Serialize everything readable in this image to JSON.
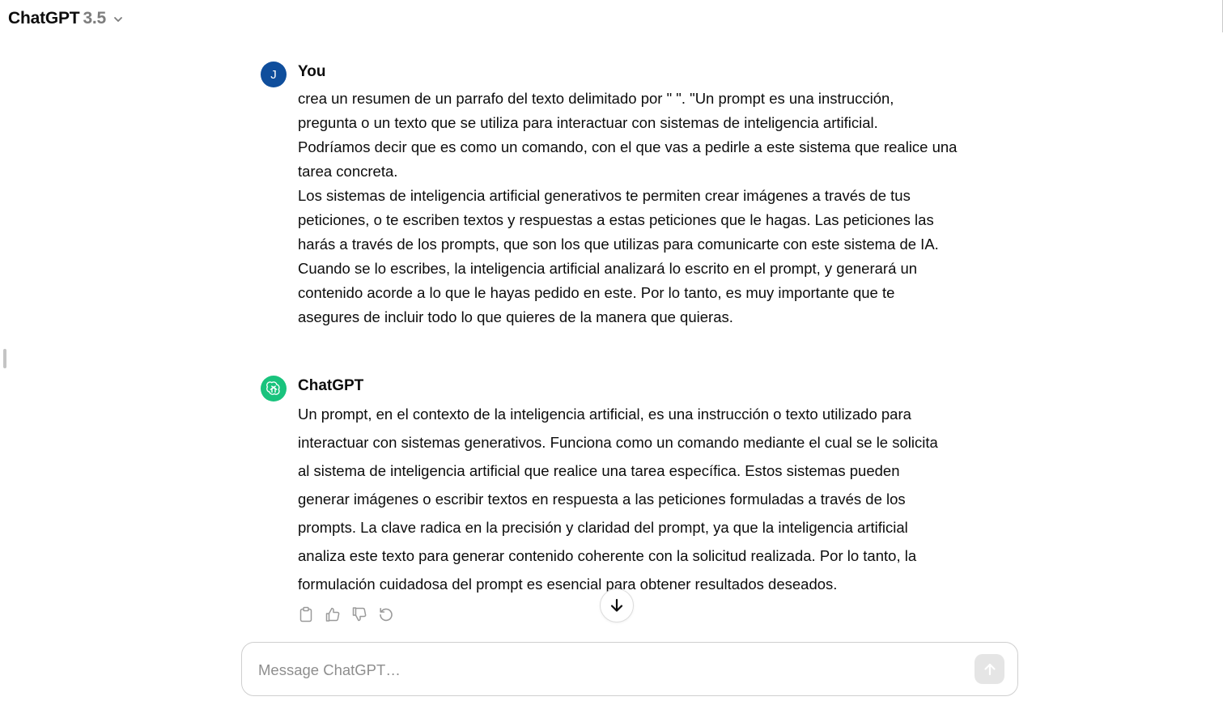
{
  "header": {
    "model_name": "ChatGPT",
    "model_version": "3.5"
  },
  "conversation": {
    "user_message": {
      "avatar_initial": "J",
      "author": "You",
      "lines": [
        "crea un resumen de un parrafo del texto delimitado por \" \".  \"Un prompt es una instrucción,",
        "pregunta o un texto que se utiliza para interactuar con sistemas de inteligencia artificial.",
        "Podríamos decir que es como un comando, con el que vas a pedirle a este sistema que realice una",
        "tarea concreta.",
        "Los sistemas de inteligencia artificial generativos te permiten crear imágenes a través de tus",
        "peticiones, o te escriben textos y respuestas a estas peticiones que le hagas. Las peticiones las",
        "harás a través de los prompts, que son los que utilizas para comunicarte con este sistema de IA.",
        "Cuando se lo escribes, la inteligencia artificial analizará lo escrito en el prompt, y generará un",
        "contenido acorde a lo que le hayas pedido en este. Por lo tanto, es muy importante que te",
        "asegures de incluir todo lo que quieres de la manera que quieras."
      ]
    },
    "assistant_message": {
      "author": "ChatGPT",
      "lines": [
        "Un prompt, en el contexto de la inteligencia artificial, es una instrucción o texto utilizado para",
        "interactuar con sistemas generativos. Funciona como un comando mediante el cual se le solicita",
        "al sistema de inteligencia artificial que realice una tarea específica. Estos sistemas pueden",
        "generar imágenes o escribir textos en respuesta a las peticiones formuladas a través de los",
        "prompts. La clave radica en la precisión y claridad del prompt, ya que la inteligencia artificial",
        "analiza este texto para generar contenido coherente con la solicitud realizada. Por lo tanto, la",
        "formulación cuidadosa del prompt es esencial para obtener resultados deseados."
      ],
      "actions": [
        "copy-icon",
        "thumbs-up-icon",
        "thumbs-down-icon",
        "regenerate-icon"
      ]
    }
  },
  "composer": {
    "placeholder": "Message ChatGPT…",
    "value": ""
  },
  "colors": {
    "user_avatar": "#0f4e9c",
    "assistant_avatar": "#19c37d",
    "send_button_disabled": "#e5e5e5",
    "placeholder_text": "#8e8e8e",
    "version_text": "#7d7d7d"
  }
}
